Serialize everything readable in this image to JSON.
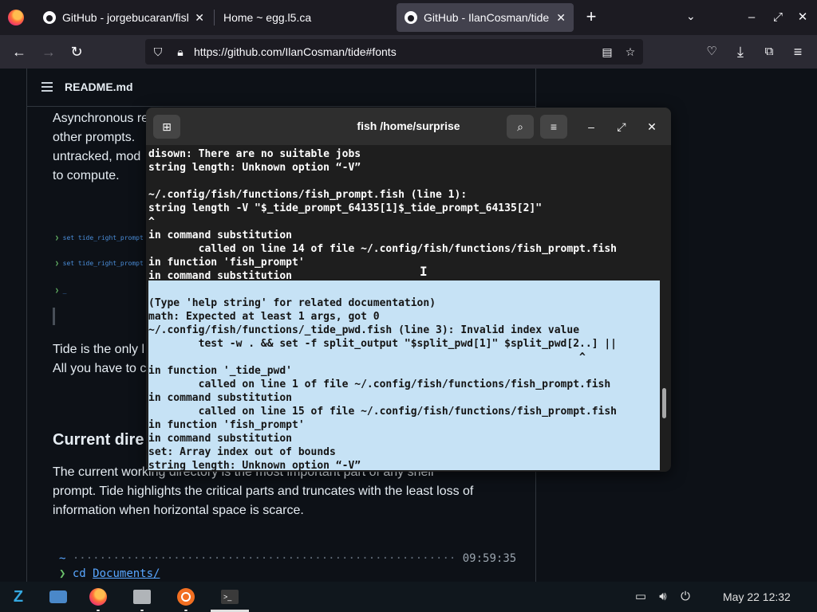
{
  "browser": {
    "tabs": [
      {
        "label": "GitHub - jorgebucaran/fish",
        "active": false
      },
      {
        "label": "Home ~ egg.l5.ca",
        "active": false
      },
      {
        "label": "GitHub - IlanCosman/tide",
        "active": true
      }
    ],
    "new_tab_label": "+",
    "url": "https://github.com/IlanCosman/tide#fonts"
  },
  "readme": {
    "title": "README.md",
    "para1": [
      "Asynchronous re",
      "other prompts.",
      "untracked, mod",
      "to compute."
    ],
    "demo_lines": [
      {
        "chev": "❯",
        "text": "set tide_right_prompt"
      },
      {
        "chev": "❯",
        "text": "set tide_right_prompt"
      },
      {
        "chev": "❯",
        "text": "_"
      }
    ],
    "para2": [
      "Tide is the only l",
      "All you have to c"
    ],
    "heading": "Current dire",
    "para3": [
      "The current working directory is the most important part of any shell",
      "prompt. Tide highlights the critical parts and truncates with the least loss of",
      "information when horizontal space is scarce."
    ],
    "code": {
      "prompt_marker": "~",
      "dots": "·························································",
      "time": "09:59:35",
      "chev": "❯",
      "cmd": "cd",
      "arg": "Documents/"
    }
  },
  "terminal": {
    "title": "fish /home/surprise",
    "lines": [
      {
        "text": "disown: There are no suitable jobs",
        "sel": false
      },
      {
        "text": "string length: Unknown option “-V”",
        "sel": false
      },
      {
        "text": "",
        "sel": false
      },
      {
        "text": "~/.config/fish/functions/fish_prompt.fish (line 1):",
        "sel": false
      },
      {
        "text": "string length -V \"$_tide_prompt_64135[1]$_tide_prompt_64135[2]\"",
        "sel": false
      },
      {
        "text": "^",
        "sel": false
      },
      {
        "text": "in command substitution",
        "sel": false
      },
      {
        "text": "        called on line 14 of file ~/.config/fish/functions/fish_prompt.fish",
        "sel": false
      },
      {
        "text": "in function 'fish_prompt'",
        "sel": false
      },
      {
        "text": "in command substitution",
        "sel": false
      },
      {
        "text": "",
        "sel": true
      },
      {
        "text": "(Type 'help string' for related documentation)",
        "sel": true
      },
      {
        "text": "math: Expected at least 1 args, got 0",
        "sel": true
      },
      {
        "text": "~/.config/fish/functions/_tide_pwd.fish (line 3): Invalid index value",
        "sel": true
      },
      {
        "text": "        test -w . && set -f split_output \"$split_pwd[1]\" $split_pwd[2..] ||",
        "sel": true
      },
      {
        "text": "                                                                     ^",
        "sel": true
      },
      {
        "text": "in function '_tide_pwd'",
        "sel": true
      },
      {
        "text": "        called on line 1 of file ~/.config/fish/functions/fish_prompt.fish",
        "sel": true
      },
      {
        "text": "in command substitution",
        "sel": true
      },
      {
        "text": "        called on line 15 of file ~/.config/fish/functions/fish_prompt.fish",
        "sel": true
      },
      {
        "text": "in function 'fish_prompt'",
        "sel": true
      },
      {
        "text": "in command substitution",
        "sel": true
      },
      {
        "text": "set: Array index out of bounds",
        "sel": true
      },
      {
        "text": "string length: Unknown option “-V”",
        "sel": true
      }
    ]
  },
  "taskbar": {
    "clock": "May 22  12:32"
  },
  "colors": {
    "selection": "#c6e2f5",
    "terminal_bg": "#1e1e1e",
    "github_bg": "#0d1117",
    "link": "#58a6ff"
  }
}
